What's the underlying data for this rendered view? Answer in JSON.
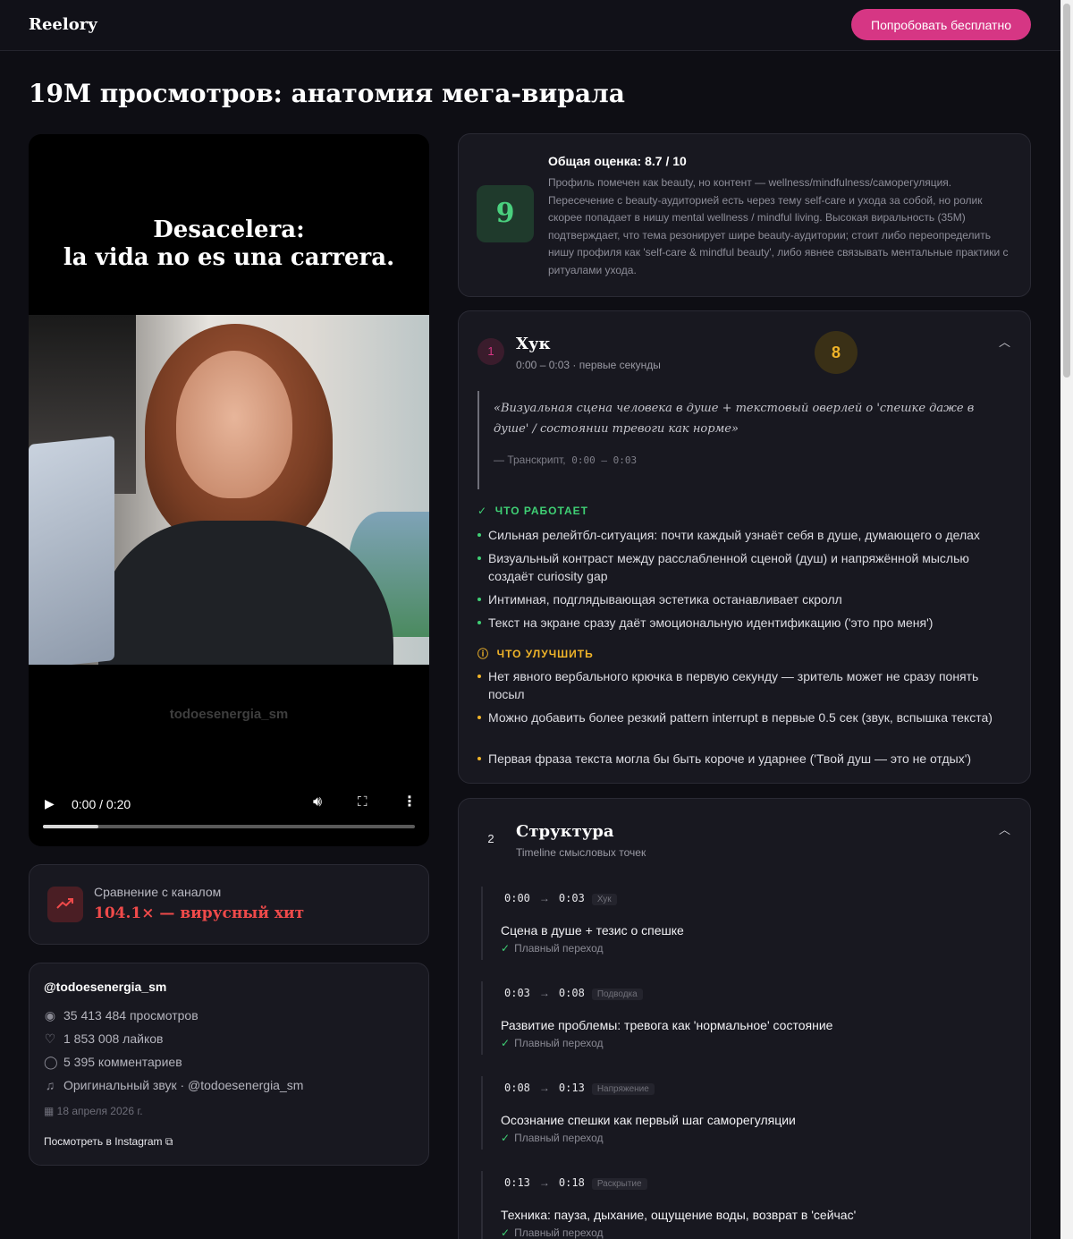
{
  "header": {
    "logo": "Reelory",
    "cta_label": "Попробовать бесплатно"
  },
  "page_title": "19M просмотров: анатомия мега-вирала",
  "video": {
    "caption_line1": "Desacelera:",
    "caption_line2": "la vida no es una carrera.",
    "watermark": "todoesenergia_sm",
    "time": "0:00 / 0:20",
    "progress": 0.15
  },
  "compare": {
    "label": "Сравнение с каналом",
    "value": "104.1× — вирусный хит"
  },
  "profile": {
    "handle": "@todoesenergia_sm",
    "views": "35 413 484 просмотров",
    "likes": "1 853 008 лайков",
    "comments": "5 395 комментариев",
    "audio": "Оригинальный звук · @todoesenergia_sm",
    "date": "18 апреля 2026 г.",
    "link": "Посмотреть в Instagram"
  },
  "overall": {
    "score": "9",
    "title": "Общая оценка: 8.7 / 10",
    "text": "Профиль помечен как beauty, но контент — wellness/mindfulness/саморегуляция. Пересечение с beauty-аудиторией есть через тему self-care и ухода за собой, но ролик скорее попадает в нишу mental wellness / mindful living. Высокая виральность (35M) подтверждает, что тема резонирует шире beauty-аудитории; стоит либо переопределить нишу профиля как 'self-care & mindful beauty', либо явнее связывать ментальные практики с ритуалами ухода."
  },
  "hook": {
    "number": "1",
    "title": "Хук",
    "subtitle": "0:00 – 0:03 · первые секунды",
    "score": "8",
    "quote": "«Визуальная сцена человека в душе + текстовый оверлей о 'спешке даже в душе' / состоянии тревоги как норме»",
    "quote_source": "— Транскрипт,",
    "quote_time": "0:00 – 0:03",
    "works_title": "ЧТО РАБОТАЕТ",
    "works": [
      "Сильная релейтбл-ситуация: почти каждый узнаёт себя в душе, думающего о делах",
      "Визуальный контраст между расслабленной сценой (душ) и напряжённой мыслью создаёт curiosity gap",
      "Интимная, подглядывающая эстетика останавливает скролл",
      "Текст на экране сразу даёт эмоциональную идентификацию ('это про меня')"
    ],
    "improve_title": "ЧТО УЛУЧШИТЬ",
    "improve": [
      "Нет явного вербального крючка в первую секунду — зритель может не сразу понять посыл",
      "Можно добавить более резкий pattern interrupt в первые 0.5 сек (звук, вспышка текста)",
      "Первая фраза текста могла бы быть короче и ударнее ('Твой душ — это не отдых')"
    ]
  },
  "structure": {
    "number": "2",
    "title": "Структура",
    "subtitle": "Timeline смысловых точек",
    "items": [
      {
        "from": "0:00",
        "to": "0:03",
        "tag": "Хук",
        "title": "Сцена в душе + тезис о спешке",
        "transition": "Плавный переход"
      },
      {
        "from": "0:03",
        "to": "0:08",
        "tag": "Подводка",
        "title": "Развитие проблемы: тревога как 'нормальное' состояние",
        "transition": "Плавный переход"
      },
      {
        "from": "0:08",
        "to": "0:13",
        "tag": "Напряжение",
        "title": "Осознание спешки как первый шаг саморегуляции",
        "transition": "Плавный переход"
      },
      {
        "from": "0:13",
        "to": "0:18",
        "tag": "Раскрытие",
        "title": "Техника: пауза, дыхание, ощущение воды, возврат в 'сейчас'",
        "transition": "Плавный переход"
      }
    ]
  },
  "colors": {
    "accent": "#d63684",
    "good": "#3fcf74",
    "warn": "#f0b429",
    "hit": "#ef4a4a",
    "score_green": "#4ad07e"
  },
  "icons": [
    "trend-up-icon",
    "eye-icon",
    "heart-icon",
    "comment-icon",
    "music-icon",
    "calendar-icon",
    "external-link-icon",
    "check-icon",
    "warning-icon",
    "chevron-up-icon",
    "play-icon",
    "volume-icon",
    "fullscreen-icon",
    "more-icon"
  ]
}
